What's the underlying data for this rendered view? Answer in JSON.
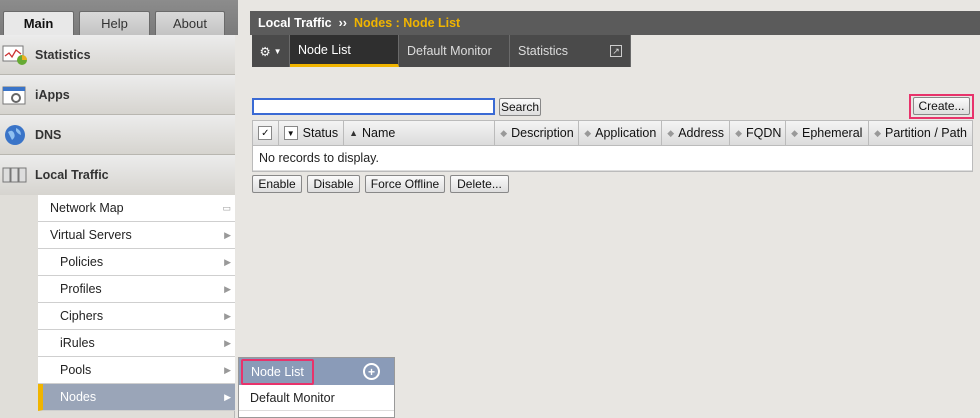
{
  "top_tabs": {
    "main": "Main",
    "help": "Help",
    "about": "About"
  },
  "sidebar": {
    "sections": [
      {
        "label": "Statistics",
        "icon": "statistics-icon"
      },
      {
        "label": "iApps",
        "icon": "iapps-icon"
      },
      {
        "label": "DNS",
        "icon": "dns-globe-icon"
      },
      {
        "label": "Local Traffic",
        "icon": "local-traffic-icon"
      }
    ],
    "items": [
      {
        "label": "Network Map"
      },
      {
        "label": "Virtual Servers"
      },
      {
        "label": "Policies"
      },
      {
        "label": "Profiles"
      },
      {
        "label": "Ciphers"
      },
      {
        "label": "iRules"
      },
      {
        "label": "Pools"
      },
      {
        "label": "Nodes"
      }
    ]
  },
  "flyout": {
    "title": "Node List",
    "items": [
      "Default Monitor"
    ]
  },
  "header": {
    "section": "Local Traffic",
    "separator": "››",
    "current": "Nodes : Node List"
  },
  "subtabs": [
    "Node List",
    "Default Monitor",
    "Statistics"
  ],
  "toolbar": {
    "search_value": "",
    "search_label": "Search",
    "create_label": "Create..."
  },
  "table": {
    "columns": [
      "Status",
      "Name",
      "Description",
      "Application",
      "Address",
      "FQDN",
      "Ephemeral",
      "Partition / Path"
    ],
    "empty_message": "No records to display."
  },
  "actions": [
    "Enable",
    "Disable",
    "Force Offline",
    "Delete..."
  ]
}
